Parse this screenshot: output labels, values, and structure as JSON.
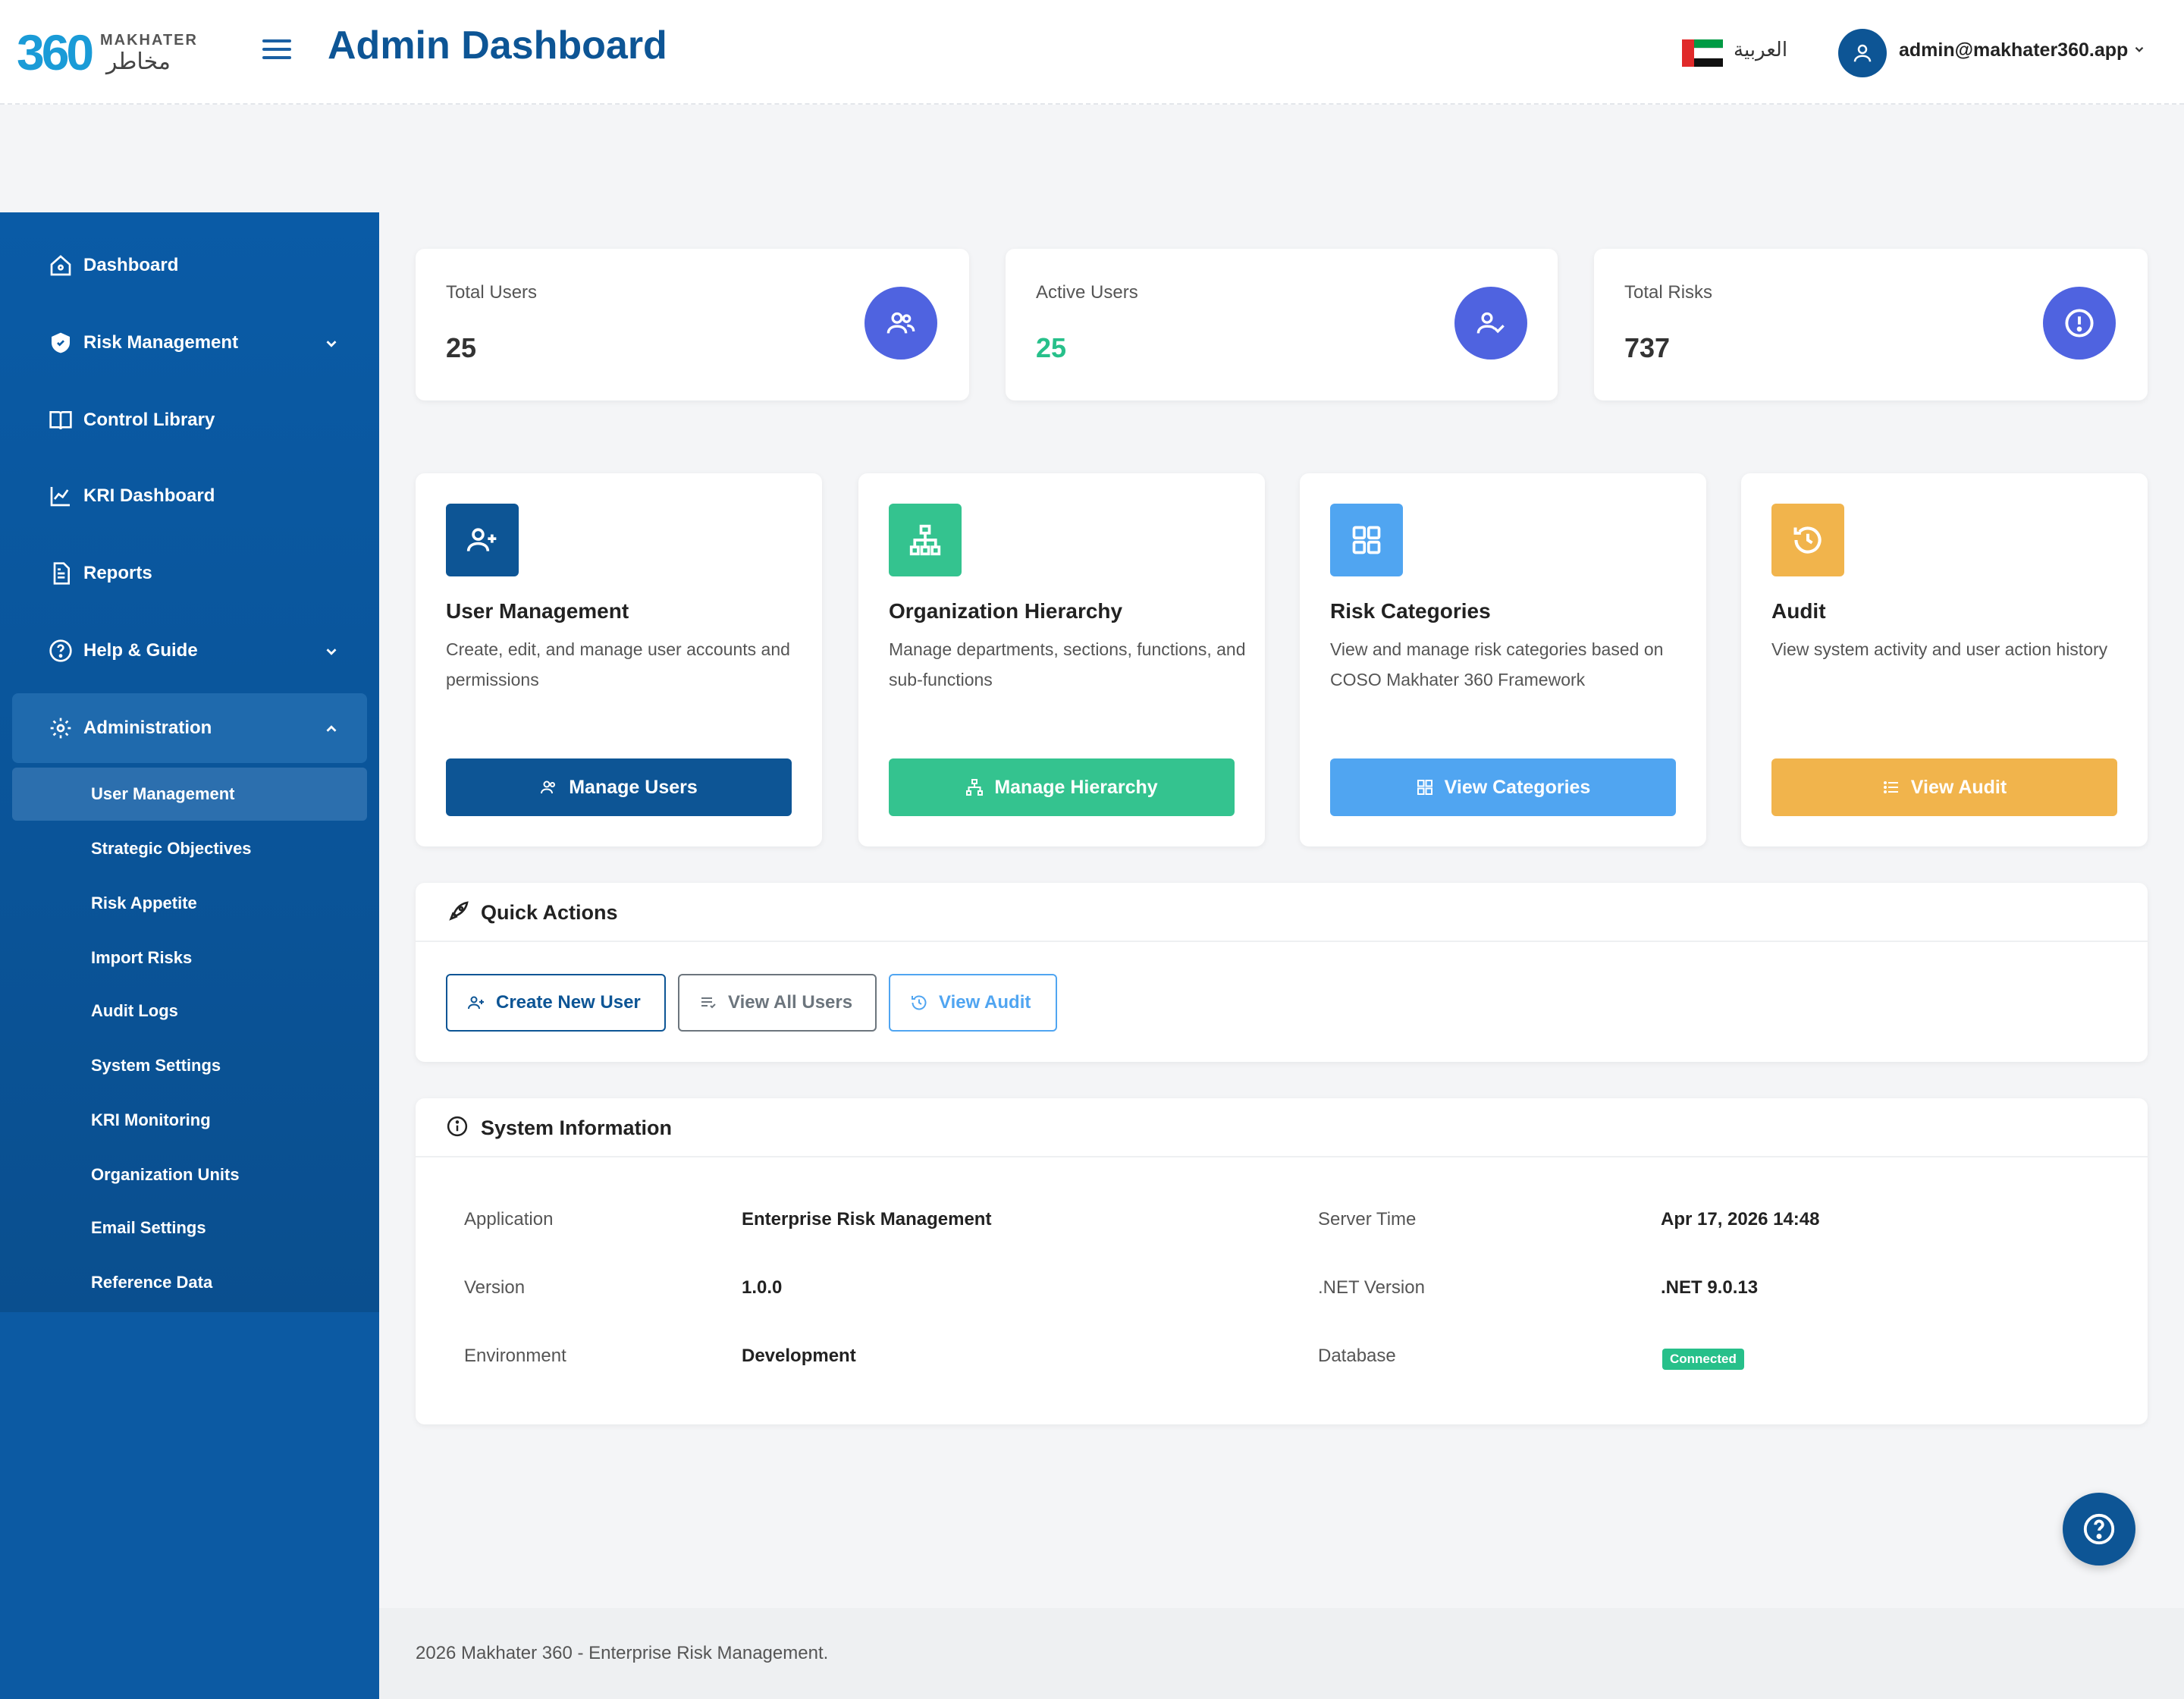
{
  "header": {
    "logo_num": "360",
    "logo_en": "MAKHATER",
    "logo_ar": "مخاطر",
    "title": "Admin Dashboard",
    "language": "العربية",
    "user_email": "admin@makhater360.app"
  },
  "sidebar": {
    "items": [
      {
        "label": "Dashboard"
      },
      {
        "label": "Risk Management"
      },
      {
        "label": "Control Library"
      },
      {
        "label": "KRI Dashboard"
      },
      {
        "label": "Reports"
      },
      {
        "label": "Help & Guide"
      },
      {
        "label": "Administration"
      }
    ],
    "subitems": [
      {
        "label": "User Management"
      },
      {
        "label": "Strategic Objectives"
      },
      {
        "label": "Risk Appetite"
      },
      {
        "label": "Import Risks"
      },
      {
        "label": "Audit Logs"
      },
      {
        "label": "System Settings"
      },
      {
        "label": "KRI Monitoring"
      },
      {
        "label": "Organization Units"
      },
      {
        "label": "Email Settings"
      },
      {
        "label": "Reference Data"
      }
    ]
  },
  "stats": [
    {
      "label": "Total Users",
      "value": "25",
      "color": "#333333"
    },
    {
      "label": "Active Users",
      "value": "25",
      "color": "#27c08a"
    },
    {
      "label": "Total Risks",
      "value": "737",
      "color": "#333333"
    }
  ],
  "features": [
    {
      "title": "User Management",
      "desc": "Create, edit, and manage user accounts and permissions",
      "button": "Manage Users",
      "color": "#0d5595"
    },
    {
      "title": "Organization Hierarchy",
      "desc": "Manage departments, sections, functions, and sub-functions",
      "button": "Manage Hierarchy",
      "color": "#34c38f"
    },
    {
      "title": "Risk Categories",
      "desc": "View and manage risk categories based on COSO Makhater 360 Framework",
      "button": "View Categories",
      "color": "#50a5f1"
    },
    {
      "title": "Audit",
      "desc": "View system activity and user action history",
      "button": "View Audit",
      "color": "#f1b44c"
    }
  ],
  "quick_actions": {
    "title": "Quick Actions",
    "buttons": [
      {
        "label": "Create New User"
      },
      {
        "label": "View All Users"
      },
      {
        "label": "View Audit"
      }
    ]
  },
  "system_info": {
    "title": "System Information",
    "rows": [
      {
        "label": "Application",
        "value": "Enterprise Risk Management"
      },
      {
        "label": "Server Time",
        "value": "Apr 17, 2026 14:48"
      },
      {
        "label": "Version",
        "value": "1.0.0"
      },
      {
        "label": ".NET Version",
        "value": ".NET 9.0.13"
      },
      {
        "label": "Environment",
        "value": "Development"
      },
      {
        "label": "Database",
        "value": "Connected"
      }
    ]
  },
  "footer": {
    "text": "2026 Makhater 360 - Enterprise Risk Management."
  },
  "colors": {
    "primary": "#0d5595",
    "sidebar": "#0a5ba6",
    "success": "#27c08a",
    "stat_icon": "#4f63e0"
  }
}
